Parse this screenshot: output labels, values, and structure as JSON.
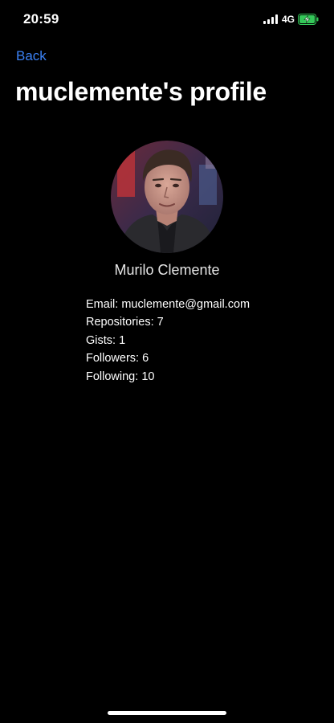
{
  "status_bar": {
    "time": "20:59",
    "network": "4G",
    "battery_color": "#34c759"
  },
  "nav": {
    "back_label": "Back",
    "title": "muclemente's profile"
  },
  "profile": {
    "name": "Murilo Clemente",
    "stats": [
      {
        "label": "Email",
        "value": "muclemente@gmail.com"
      },
      {
        "label": "Repositories",
        "value": "7"
      },
      {
        "label": "Gists",
        "value": "1"
      },
      {
        "label": "Followers",
        "value": "6"
      },
      {
        "label": "Following",
        "value": "10"
      }
    ]
  },
  "colors": {
    "background": "#000000",
    "accent": "#3b82f6",
    "text": "#ffffff"
  }
}
